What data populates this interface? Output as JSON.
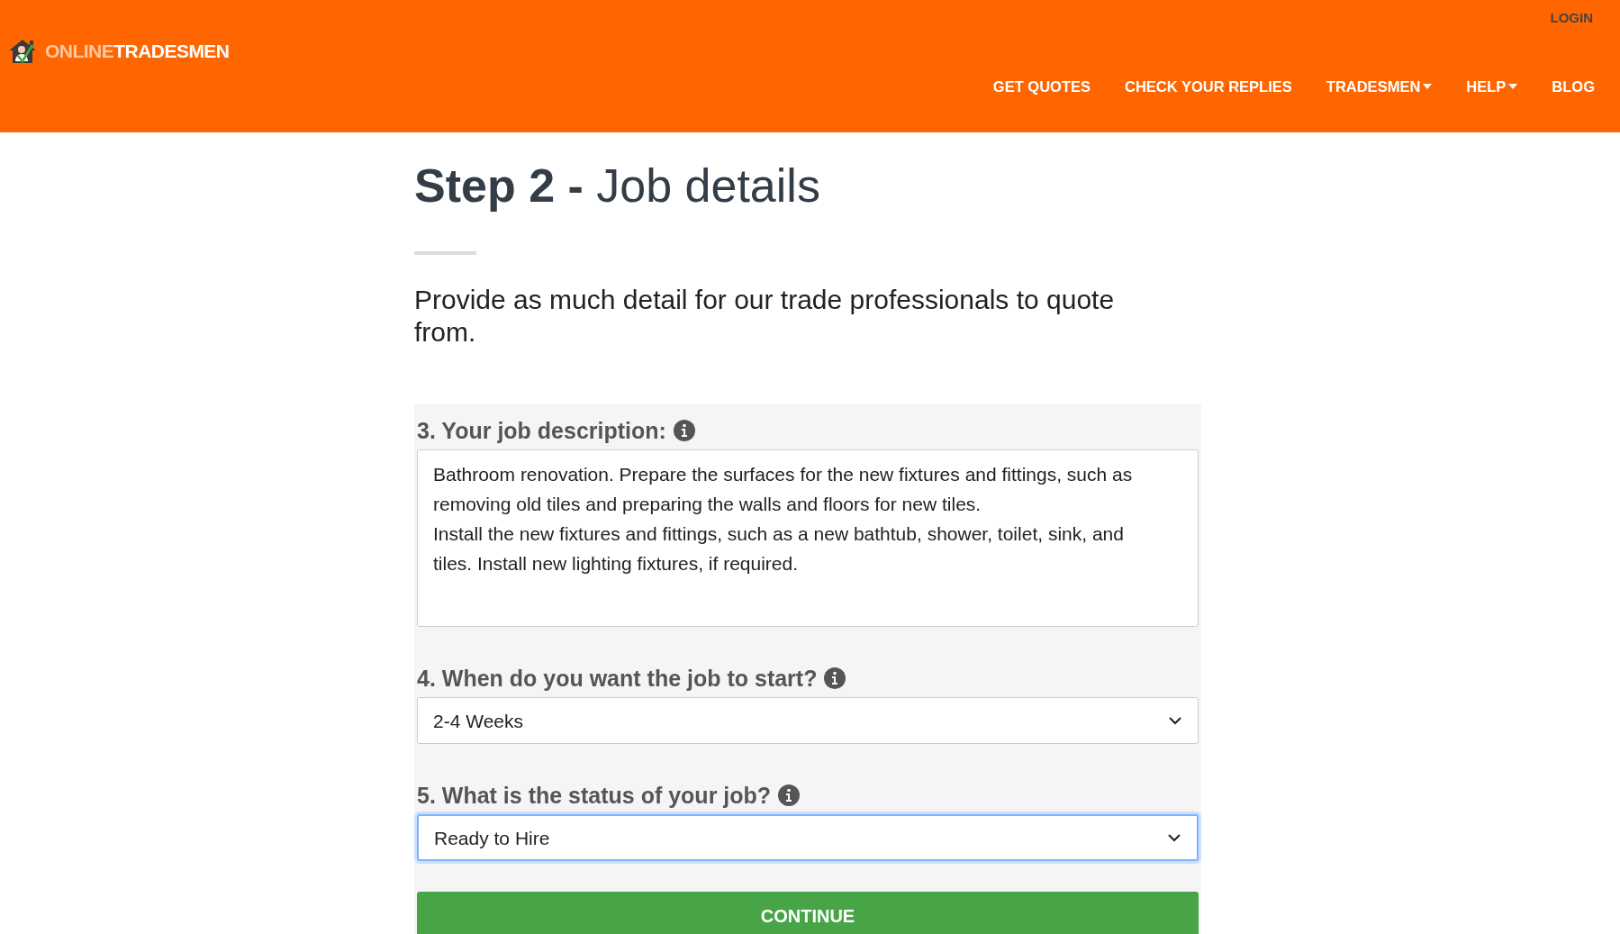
{
  "header": {
    "brand": {
      "part_1": "ONLINE",
      "part_2": "TRADESMEN"
    },
    "login": "LOGIN",
    "nav": [
      {
        "label": "GET QUOTES",
        "dropdown": false
      },
      {
        "label": "CHECK YOUR REPLIES",
        "dropdown": false
      },
      {
        "label": "TRADESMEN",
        "dropdown": true
      },
      {
        "label": "HELP",
        "dropdown": true
      },
      {
        "label": "BLOG",
        "dropdown": false
      }
    ]
  },
  "heading": {
    "bold": "Step 2 -",
    "light": "Job details"
  },
  "intro": "Provide as much detail for our trade professionals to quote from.",
  "fields": [
    {
      "kind": "textarea",
      "label": "3. Your job description:",
      "value": "Bathroom renovation. Prepare the surfaces for the new fixtures and fittings, such as removing old tiles and preparing the walls and floors for new tiles.\nInstall the new fixtures and fittings, such as a new bathtub, shower, toilet, sink, and tiles. Install new lighting fixtures, if required.",
      "focused": false
    },
    {
      "kind": "select",
      "label": "4. When do you want the job to start?",
      "value": "2-4 Weeks",
      "focused": false
    },
    {
      "kind": "select",
      "label": "5. What is the status of your job?",
      "value": "Ready to Hire",
      "focused": true
    }
  ],
  "continue_button": "CONTINUE"
}
